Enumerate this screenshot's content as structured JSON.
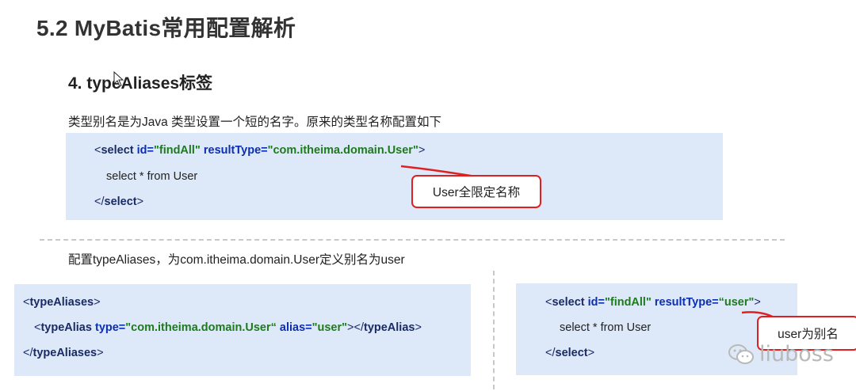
{
  "slide": {
    "title": "5.2 MyBatis常用配置解析",
    "subtitle": "4. typeAliases标签",
    "description": "类型别名是为Java 类型设置一个短的名字。原来的类型名称配置如下",
    "description2": "配置typeAliases，为com.itheima.domain.User定义别名为user"
  },
  "code1": {
    "open_lt": "<",
    "tag": "select",
    "attr_id": "id=",
    "val_id": "\"findAll\"",
    "attr_rt": "resultType=",
    "val_rt": "\"com.itheima.domain.User\"",
    "open_gt": ">",
    "body": "select * from User",
    "close_lt": "</",
    "close_tag": "select",
    "close_gt": ">"
  },
  "code2": {
    "line1_lt": "<",
    "line1_tag": "typeAliases",
    "line1_gt": ">",
    "line2_lt": "<",
    "line2_tag": "typeAlias",
    "line2_attr_type": "type=",
    "line2_val_type": "\"com.itheima.domain.User“",
    "line2_attr_alias": "alias=",
    "line2_val_alias": "\"user\"",
    "line2_mid": "></",
    "line2_close_tag": "typeAlias",
    "line2_gt": ">",
    "line3_lt": "</",
    "line3_tag": "typeAliases",
    "line3_gt": ">"
  },
  "code3": {
    "open_lt": "<",
    "tag": "select",
    "attr_id": "id=",
    "val_id": "\"findAll\"",
    "attr_rt": "resultType=",
    "val_rt": "“user\"",
    "open_gt": ">",
    "body": "select * from User",
    "close_lt": "</",
    "close_tag": "select",
    "close_gt": ">"
  },
  "callouts": {
    "full_name": "User全限定名称",
    "alias": "user为别名"
  },
  "watermark": {
    "text": "liuboss",
    "icon": "wechat-icon"
  },
  "colors": {
    "code_bg": "#dde9f8",
    "callout_border": "#e02020",
    "attr": "#0b2fb0",
    "value": "#1d7a1d"
  }
}
